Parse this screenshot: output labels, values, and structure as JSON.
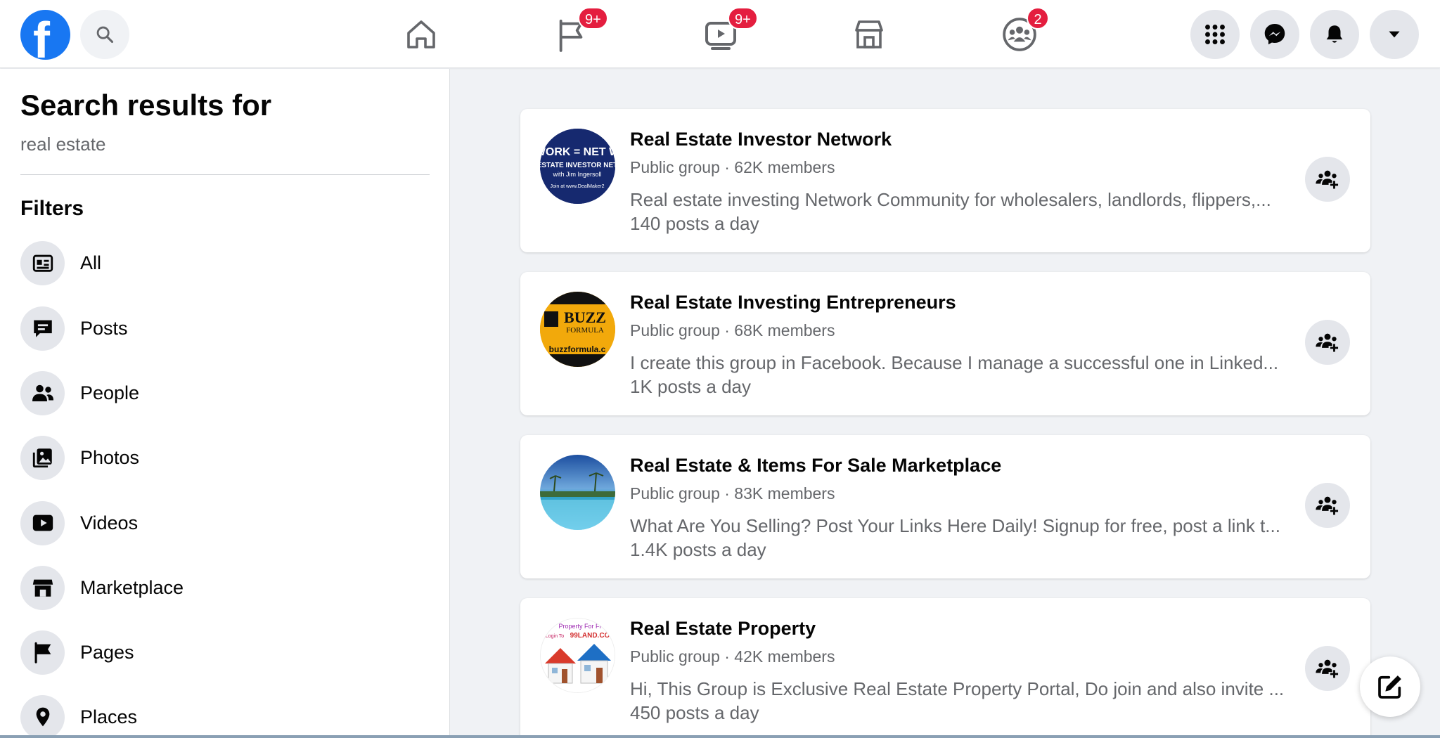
{
  "header": {
    "logo_letter": "f",
    "badges": {
      "pages": "9+",
      "watch": "9+",
      "groups": "2"
    }
  },
  "sidebar": {
    "title": "Search results for",
    "query": "real estate",
    "filters_title": "Filters",
    "filters": [
      {
        "label": "All",
        "icon": "news-feed-icon"
      },
      {
        "label": "Posts",
        "icon": "comment-icon"
      },
      {
        "label": "People",
        "icon": "people-icon"
      },
      {
        "label": "Photos",
        "icon": "photos-icon"
      },
      {
        "label": "Videos",
        "icon": "video-play-icon"
      },
      {
        "label": "Marketplace",
        "icon": "store-icon"
      },
      {
        "label": "Pages",
        "icon": "flag-icon"
      },
      {
        "label": "Places",
        "icon": "map-pin-icon"
      }
    ]
  },
  "results": [
    {
      "title": "Real Estate Investor Network",
      "meta": "Public group · 62K members",
      "description": "Real estate investing Network Community for wholesalers, landlords, flippers,...",
      "activity": "140 posts a day",
      "avatar_text": [
        "WORK = NET W",
        "ESTATE INVESTOR NET",
        "with Jim Ingersoll",
        "Join at www.DealMaker2"
      ]
    },
    {
      "title": "Real Estate Investing Entrepreneurs",
      "meta": "Public group · 68K members",
      "description": "I create this group in Facebook. Because I manage a successful one in Linked...",
      "activity": "1K posts a day",
      "avatar_text": [
        "BUZZ",
        "FORMULA",
        "buzzformula.c"
      ]
    },
    {
      "title": "Real Estate & Items For Sale Marketplace",
      "meta": "Public group · 83K members",
      "description": "What Are You Selling? Post Your Links Here Daily! Signup for free, post a link t...",
      "activity": "1.4K posts a day"
    },
    {
      "title": "Real Estate Property",
      "meta": "Public group · 42K members",
      "description": "Hi, This Group is Exclusive Real Estate Property Portal, Do join and also invite ...",
      "activity": "450 posts a day",
      "avatar_text": [
        "Property For Fr",
        "Login To",
        "99LAND.CO"
      ]
    }
  ]
}
